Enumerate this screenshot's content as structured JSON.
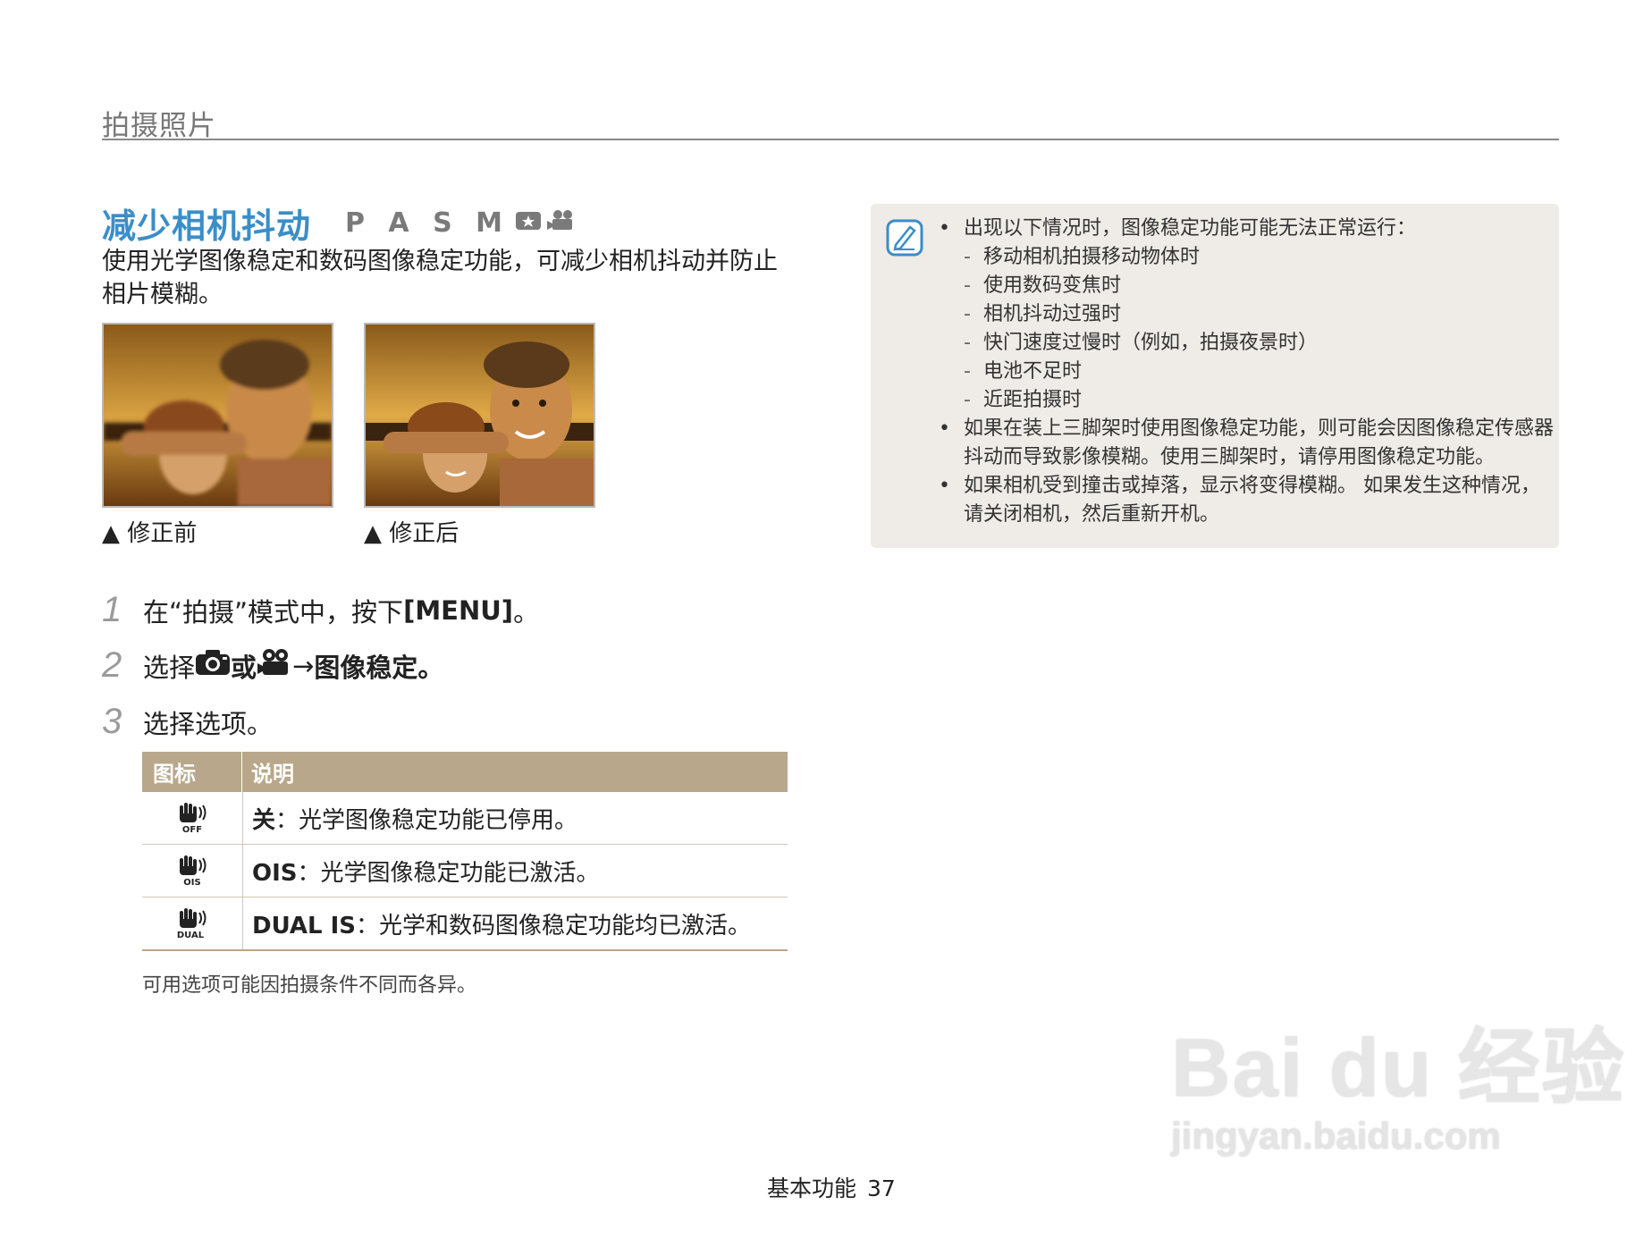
{
  "section_title": "拍摄照片",
  "heading": "减少相机抖动",
  "modes": "P A S M",
  "mode_icons": [
    "scene-icon",
    "movie-icon"
  ],
  "intro": "使用光学图像稳定和数码图像稳定功能，可减少相机抖动并防止相片模糊。",
  "photos": {
    "before_caption": "▲ 修正前",
    "after_caption": "▲ 修正后"
  },
  "steps": [
    {
      "num": "1",
      "pre": "在“拍摄”模式中，按下 ",
      "key": "[MENU]",
      "post": "。"
    },
    {
      "num": "2",
      "pre": "选择 ",
      "mid": " 或 ",
      "arrow": " → ",
      "target": "图像稳定",
      "post": "。"
    },
    {
      "num": "3",
      "text": "选择选项。"
    }
  ],
  "table": {
    "headers": [
      "图标",
      "说明"
    ],
    "rows": [
      {
        "icon": "ois-off-icon",
        "icon_text": "OFF",
        "name": "关",
        "desc": "：光学图像稳定功能已停用。"
      },
      {
        "icon": "ois-on-icon",
        "icon_text": "OIS",
        "name": "OIS",
        "desc": "：光学图像稳定功能已激活。"
      },
      {
        "icon": "dual-is-icon",
        "icon_text": "DUAL",
        "name": "DUAL IS",
        "desc": "：光学和数码图像稳定功能均已激活。"
      }
    ]
  },
  "footnote": "可用选项可能因拍摄条件不同而各异。",
  "note": {
    "bullet1": "出现以下情况时，图像稳定功能可能无法正常运行：",
    "subs": [
      "移动相机拍摄移动物体时",
      "使用数码变焦时",
      "相机抖动过强时",
      "快门速度过慢时（例如，拍摄夜景时）",
      "电池不足时",
      "近距拍摄时"
    ],
    "bullet2": "如果在装上三脚架时使用图像稳定功能，则可能会因图像稳定传感器抖动而导致影像模糊。使用三脚架时，请停用图像稳定功能。",
    "bullet3": "如果相机受到撞击或掉落，显示将变得模糊。 如果发生这种情况，请关闭相机，然后重新开机。"
  },
  "footer": {
    "label": "基本功能",
    "page": "37"
  },
  "watermark": {
    "brand": "Bai du 经验",
    "sub": "jingyan.baidu.com"
  },
  "colors": {
    "heading": "#3a8ec8",
    "table_header": "#b8a78a",
    "note_bg": "#efebe6"
  }
}
